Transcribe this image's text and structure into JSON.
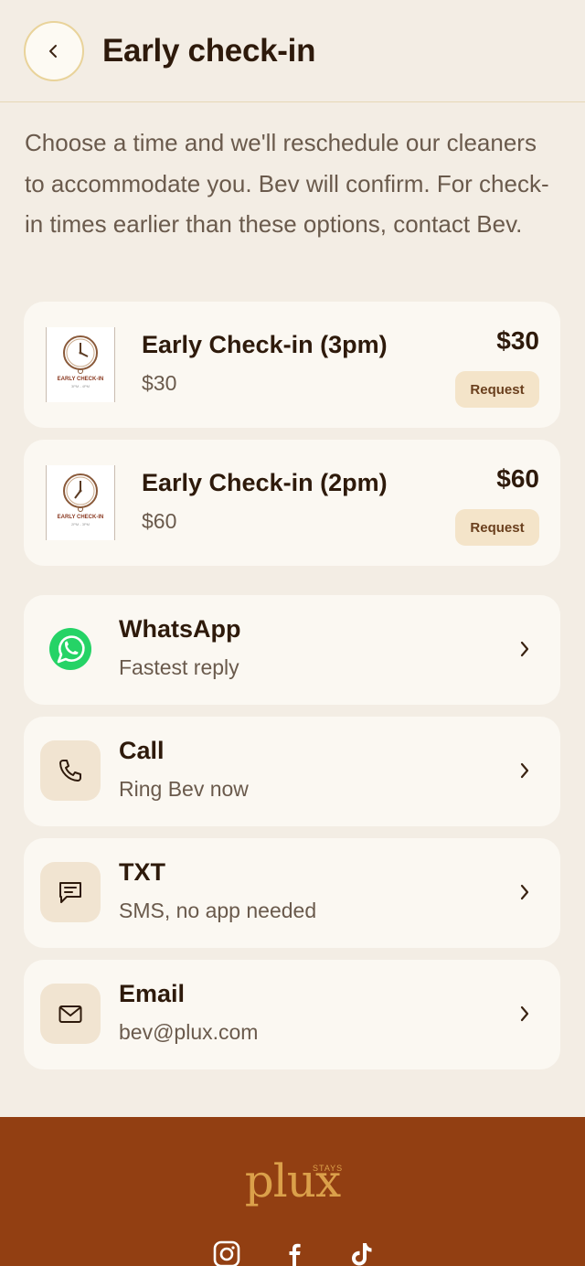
{
  "header": {
    "title": "Early check-in",
    "back_icon": "chevron-left-icon"
  },
  "intro": "Choose a time and we'll reschedule our cleaners to accommodate you. Bev will confirm. For check-in times earlier than these options, contact Bev.",
  "offers": [
    {
      "name": "Early Check-in (3pm)",
      "subtitle": "$30",
      "price": "$30",
      "button": "Request",
      "thumb_caption": "EARLY CHECK-IN",
      "thumb_sub": "3PM - 4PM"
    },
    {
      "name": "Early Check-in (2pm)",
      "subtitle": "$60",
      "price": "$60",
      "button": "Request",
      "thumb_caption": "EARLY CHECK-IN",
      "thumb_sub": "2PM - 3PM"
    }
  ],
  "contacts": [
    {
      "title": "WhatsApp",
      "subtitle": "Fastest reply",
      "icon": "whatsapp-icon"
    },
    {
      "title": "Call",
      "subtitle": "Ring Bev now",
      "icon": "phone-icon"
    },
    {
      "title": "TXT",
      "subtitle": "SMS, no app needed",
      "icon": "message-icon"
    },
    {
      "title": "Email",
      "subtitle": "bev@plux.com",
      "icon": "mail-icon"
    }
  ],
  "footer": {
    "logo": "plux",
    "logo_sub": "STAYS",
    "socials": [
      "instagram-icon",
      "facebook-icon",
      "tiktok-icon"
    ]
  },
  "colors": {
    "background": "#f3ede4",
    "card": "#fbf8f2",
    "text": "#2e1a0b",
    "muted": "#6a5a4c",
    "accent_button": "#f4e4c9",
    "footer": "#923f12",
    "logo": "#dba04a",
    "whatsapp": "#25d366"
  }
}
